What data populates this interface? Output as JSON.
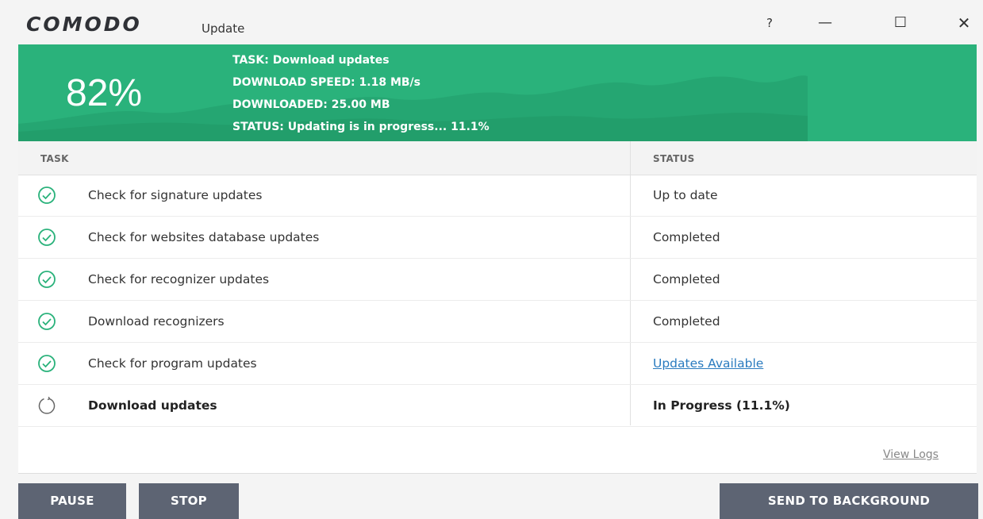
{
  "window": {
    "brand": "COMODO",
    "title": "Update",
    "controls": {
      "help": "?",
      "minimize": "—",
      "maximize": "☐",
      "close": "✕"
    }
  },
  "banner": {
    "percent": "82%",
    "task": "TASK: Download updates",
    "speed": "DOWNLOAD SPEED: 1.18 MB/s",
    "downloaded": "DOWNLOADED: 25.00 MB",
    "status": "STATUS: Updating is in progress... 11.1%",
    "color": "#2ab27b"
  },
  "table": {
    "headers": {
      "task": "TASK",
      "status": "STATUS"
    },
    "rows": [
      {
        "task": "Check for signature updates",
        "status": "Up to date",
        "icon": "check-circle-icon"
      },
      {
        "task": "Check for websites database updates",
        "status": "Completed",
        "icon": "check-circle-icon"
      },
      {
        "task": "Check for recognizer updates",
        "status": "Completed",
        "icon": "check-circle-icon"
      },
      {
        "task": "Download recognizers",
        "status": "Completed",
        "icon": "check-circle-icon"
      },
      {
        "task": "Check for program updates",
        "status": "Updates Available",
        "icon": "check-circle-icon"
      },
      {
        "task": "Download updates",
        "status": "In Progress (11.1%)",
        "icon": "refresh-icon"
      }
    ],
    "view_logs": "View Logs"
  },
  "buttons": {
    "pause": "PAUSE",
    "stop": "STOP",
    "send_to_background": "SEND TO BACKGROUND"
  }
}
